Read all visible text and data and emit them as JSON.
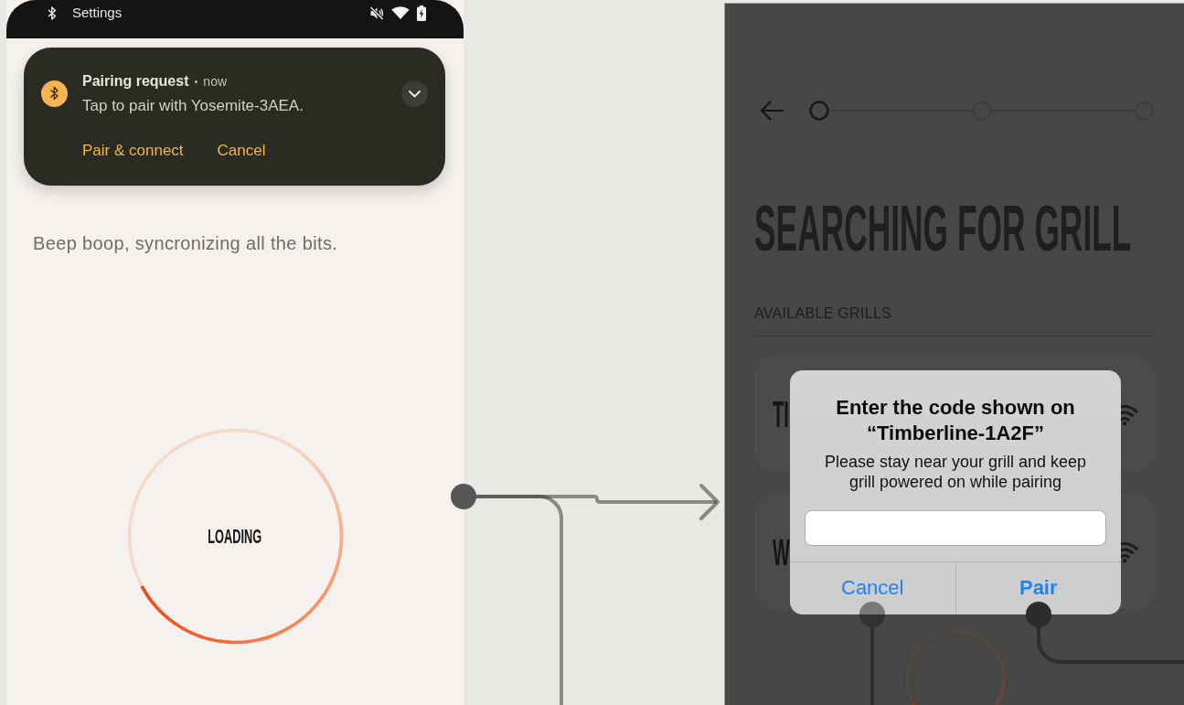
{
  "android_screen": {
    "status_bar": {
      "app_label": "Settings"
    },
    "notification": {
      "title": "Pairing request",
      "separator": "•",
      "time": "now",
      "message": "Tap to pair with Yosemite-3AEA.",
      "actions": [
        "Pair & connect",
        "Cancel"
      ]
    },
    "subtitle": "Beep boop, syncronizing all the bits.",
    "loader": {
      "label": "LOADING"
    }
  },
  "ios_screen": {
    "stepper": {
      "steps": [
        {
          "selected": true
        },
        {
          "selected": false
        },
        {
          "selected": false
        }
      ]
    },
    "heading": "SEARCHING FOR GRILL",
    "section_label": "AVAILABLE GRILLS",
    "grills": [
      {
        "name": "TI"
      },
      {
        "name": "W"
      }
    ],
    "dialog": {
      "title": "Enter the code shown on “Timberline-1A2F”",
      "message": "Please stay near your grill and keep grill powered on while pairing",
      "actions": [
        {
          "label": "Cancel",
          "kind": "cancel"
        },
        {
          "label": "Pair",
          "kind": "confirm"
        }
      ]
    }
  }
}
